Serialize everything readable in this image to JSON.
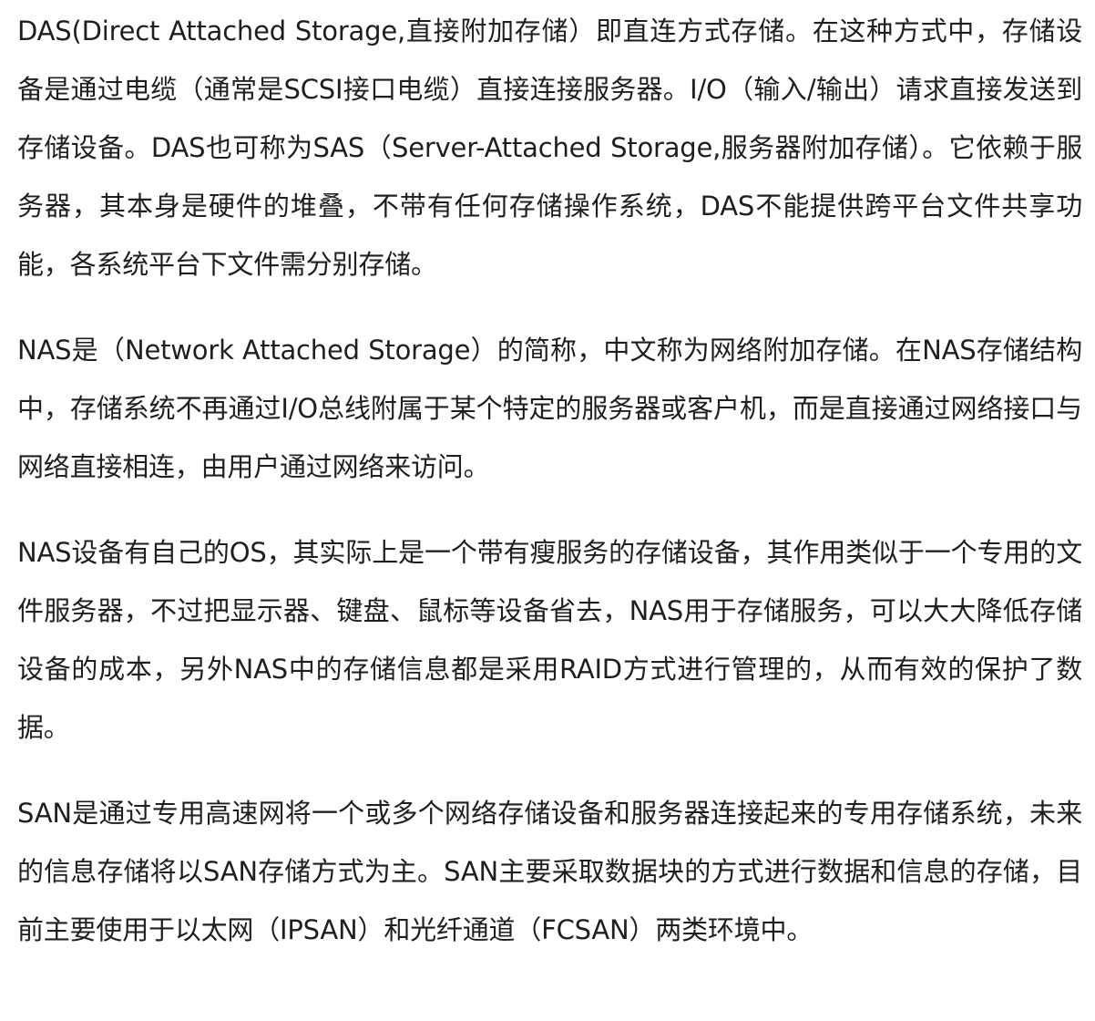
{
  "document": {
    "paragraphs": [
      "DAS(Direct Attached Storage,直接附加存储）即直连方式存储。在这种方式中，存储设备是通过电缆（通常是SCSI接口电缆）直接连接服务器。I/O（输入/输出）请求直接发送到存储设备。DAS也可称为SAS（Server-Attached Storage,服务器附加存储）。它依赖于服务器，其本身是硬件的堆叠，不带有任何存储操作系统，DAS不能提供跨平台文件共享功能，各系统平台下文件需分别存储。",
      "NAS是（Network Attached Storage）的简称，中文称为网络附加存储。在NAS存储结构中，存储系统不再通过I/O总线附属于某个特定的服务器或客户机，而是直接通过网络接口与网络直接相连，由用户通过网络来访问。",
      "NAS设备有自己的OS，其实际上是一个带有瘦服务的存储设备，其作用类似于一个专用的文件服务器，不过把显示器、键盘、鼠标等设备省去，NAS用于存储服务，可以大大降低存储设备的成本，另外NAS中的存储信息都是采用RAID方式进行管理的，从而有效的保护了数据。",
      "SAN是通过专用高速网将一个或多个网络存储设备和服务器连接起来的专用存储系统，未来的信息存储将以SAN存储方式为主。SAN主要采取数据块的方式进行数据和信息的存储，目前主要使用于以太网（IPSAN）和光纤通道（FCSAN）两类环境中。"
    ]
  }
}
